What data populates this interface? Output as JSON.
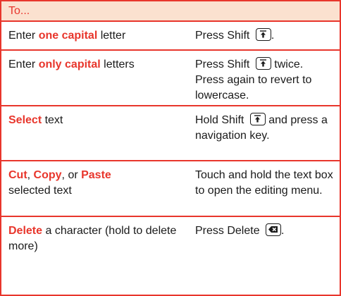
{
  "header": {
    "label": "To..."
  },
  "rows": [
    {
      "action": [
        "Enter ",
        "one capital",
        " letter"
      ],
      "how": [
        "Press Shift ",
        "."
      ]
    },
    {
      "action": [
        "Enter ",
        "only capital",
        " letters"
      ],
      "how": [
        "Press Shift ",
        " twice. Press again to revert to lowercase."
      ]
    },
    {
      "action": [
        "Select",
        " text"
      ],
      "how": [
        "Hold Shift ",
        " and press a navigation key."
      ]
    },
    {
      "action": [
        "Cut",
        ", ",
        "Copy",
        ", or ",
        "Paste",
        " selected text"
      ],
      "how": [
        "Touch and hold the text box to open the editing menu."
      ]
    },
    {
      "action": [
        "Delete",
        " a character (hold to delete more)"
      ],
      "how": [
        "Press Delete ",
        "."
      ]
    }
  ],
  "icons": {
    "shift": "shift-key-icon",
    "delete": "delete-key-icon"
  },
  "colors": {
    "accent": "#e8362c",
    "header_bg": "#fbe1cf"
  }
}
